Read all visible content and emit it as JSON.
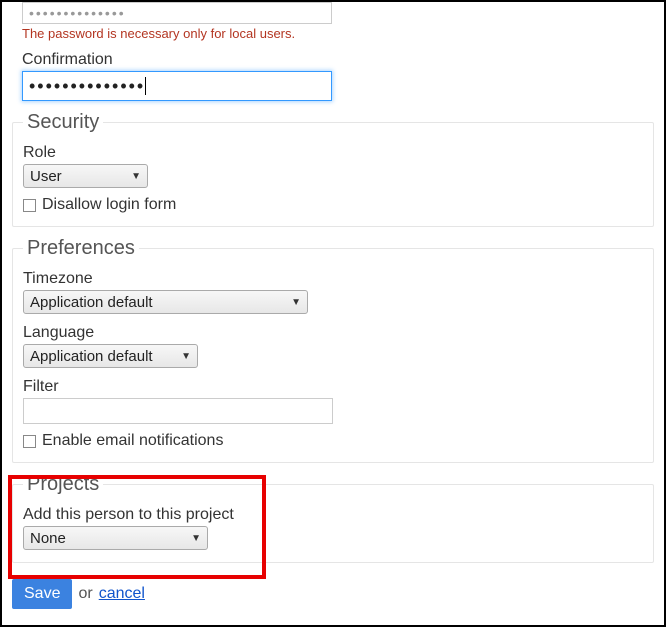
{
  "password": {
    "value_mask": "••••••••••••••",
    "helper": "The password is necessary only for local users."
  },
  "confirmation": {
    "label": "Confirmation",
    "value_mask": "••••••••••••••"
  },
  "security": {
    "legend": "Security",
    "role_label": "Role",
    "role_value": "User",
    "disallow_label": "Disallow login form"
  },
  "preferences": {
    "legend": "Preferences",
    "timezone_label": "Timezone",
    "timezone_value": "Application default",
    "language_label": "Language",
    "language_value": "Application default",
    "filter_label": "Filter",
    "email_label": "Enable email notifications"
  },
  "projects": {
    "legend": "Projects",
    "add_label": "Add this person to this project",
    "add_value": "None"
  },
  "actions": {
    "save": "Save",
    "or": "or",
    "cancel": "cancel"
  }
}
